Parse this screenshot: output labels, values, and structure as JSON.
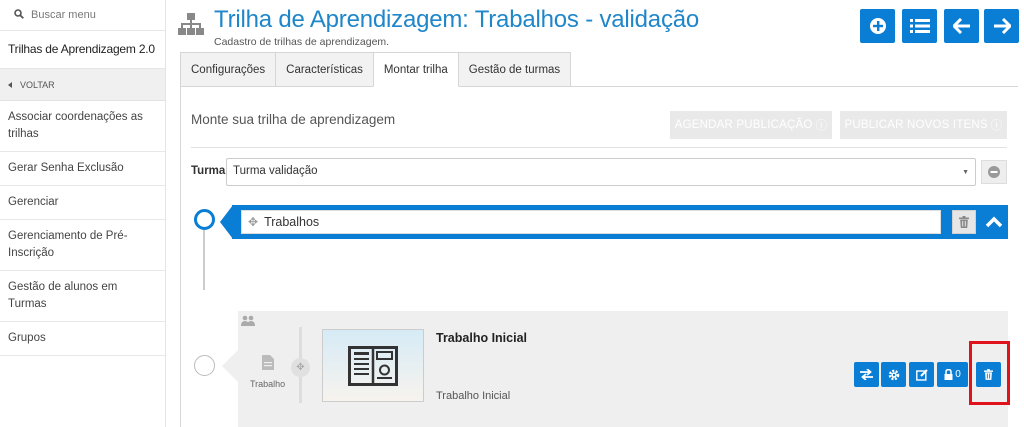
{
  "sidebar": {
    "search_placeholder": "Buscar menu",
    "app_title": "Trilhas de Aprendizagem 2.0",
    "back_label": "VOLTAR",
    "items": [
      {
        "label": "Associar coordenações as trilhas"
      },
      {
        "label": "Gerar Senha Exclusão"
      },
      {
        "label": "Gerenciar"
      },
      {
        "label": "Gerenciamento de Pré-Inscrição"
      },
      {
        "label": "Gestão de alunos em Turmas"
      },
      {
        "label": "Grupos"
      }
    ]
  },
  "header": {
    "title": "Trilha de Aprendizagem: Trabalhos - validação",
    "subtitle": "Cadastro de trilhas de aprendizagem."
  },
  "tabs": [
    {
      "label": "Configurações"
    },
    {
      "label": "Características"
    },
    {
      "label": "Montar trilha"
    },
    {
      "label": "Gestão de turmas"
    }
  ],
  "builder": {
    "section_title": "Monte sua trilha de aprendizagem",
    "schedule_button": "AGENDAR PUBLICAÇÃO",
    "publish_button": "PUBLICAR NOVOS ITENS",
    "turma_label": "Turma",
    "turma_value": "Turma validação",
    "step_name": "Trabalhos"
  },
  "item": {
    "type_label": "Trabalho",
    "title": "Trabalho Inicial",
    "description": "Trabalho Inicial",
    "lock_count": "0"
  },
  "colors": {
    "primary": "#0a7ed4",
    "title": "#1f86c9",
    "highlight": "#e0131c"
  }
}
